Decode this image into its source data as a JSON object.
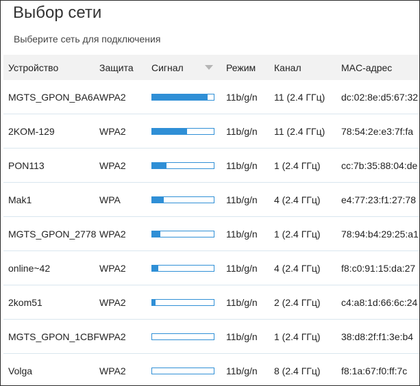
{
  "dialog": {
    "title": "Выбор сети",
    "subtitle": "Выберите сеть для подключения"
  },
  "columns": {
    "device": "Устройство",
    "security": "Защита",
    "signal": "Сигнал",
    "mode": "Режим",
    "channel": "Канал",
    "mac": "MAC-адрес"
  },
  "sort": {
    "column": "signal",
    "direction": "descending",
    "icon": "sort-desc-triangle-icon"
  },
  "colors": {
    "signal_bar": "#2f8fd6",
    "row_divider": "#d9e6ee",
    "header_bg": "#f2f2f2"
  },
  "networks": [
    {
      "device": "MGTS_GPON_BA6A",
      "security": "WPA2",
      "signal": 0.9,
      "mode": "11b/g/n",
      "channel": "11 (2.4 ГГц)",
      "mac": "dc:02:8e:d5:67:32"
    },
    {
      "device": "2KOM-129",
      "security": "WPA2",
      "signal": 0.57,
      "mode": "11b/g/n",
      "channel": "11 (2.4 ГГц)",
      "mac": "78:54:2e:e3:7f:fa"
    },
    {
      "device": "PON113",
      "security": "WPA2",
      "signal": 0.23,
      "mode": "11b/g/n",
      "channel": "1 (2.4 ГГц)",
      "mac": "cc:7b:35:88:04:de"
    },
    {
      "device": "Mak1",
      "security": "WPA",
      "signal": 0.19,
      "mode": "11b/g/n",
      "channel": "4 (2.4 ГГц)",
      "mac": "e4:77:23:f1:27:78"
    },
    {
      "device": "MGTS_GPON_2778",
      "security": "WPA2",
      "signal": 0.13,
      "mode": "11b/g/n",
      "channel": "1 (2.4 ГГц)",
      "mac": "78:94:b4:29:25:a1"
    },
    {
      "device": "online~42",
      "security": "WPA2",
      "signal": 0.1,
      "mode": "11b/g/n",
      "channel": "4 (2.4 ГГц)",
      "mac": "f8:c0:91:15:da:27"
    },
    {
      "device": "2kom51",
      "security": "WPA2",
      "signal": 0.05,
      "mode": "11b/g/n",
      "channel": "2 (2.4 ГГц)",
      "mac": "c4:a8:1d:66:6c:24"
    },
    {
      "device": "MGTS_GPON_1CBF",
      "security": "WPA2",
      "signal": 0.0,
      "mode": "11b/g/n",
      "channel": "1 (2.4 ГГц)",
      "mac": "38:d8:2f:f1:3e:b4"
    },
    {
      "device": "Volga",
      "security": "WPA2",
      "signal": 0.0,
      "mode": "11b/g/n",
      "channel": "8 (2.4 ГГц)",
      "mac": "f8:1a:67:f0:ff:7c"
    }
  ]
}
